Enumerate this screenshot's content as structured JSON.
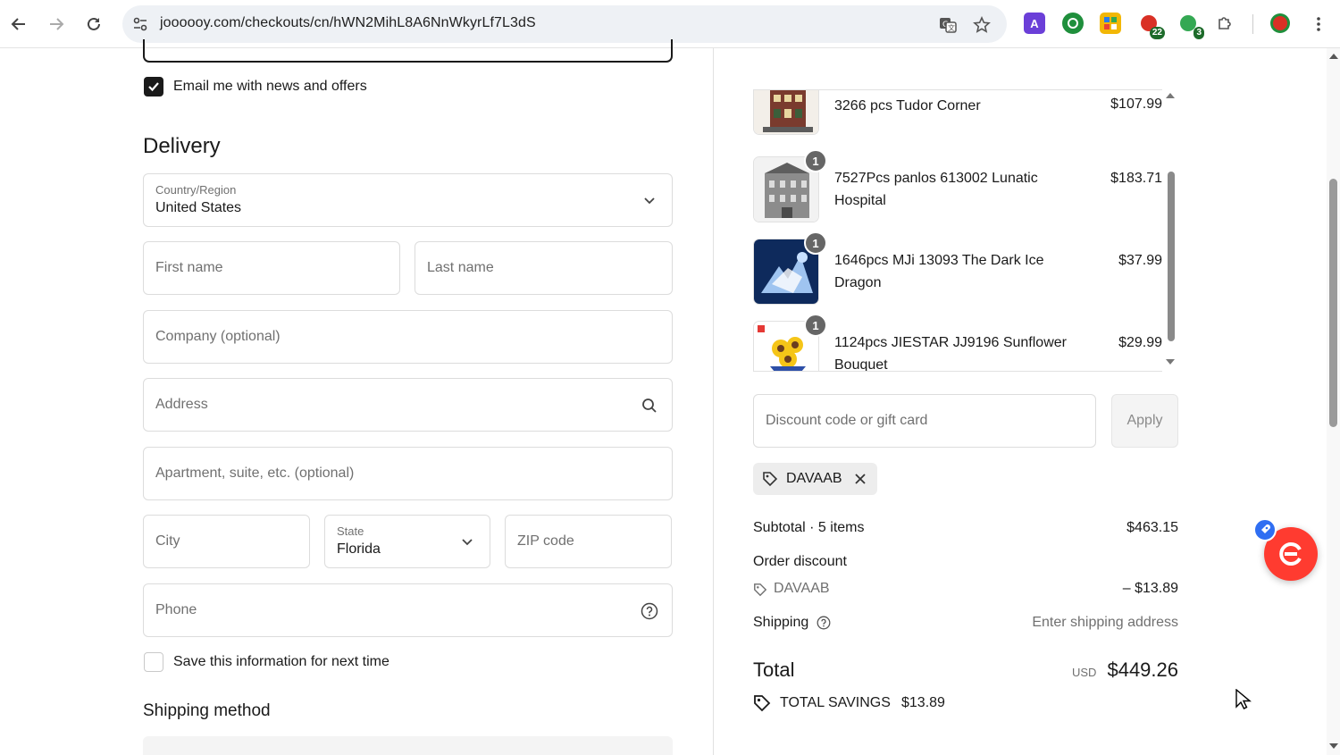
{
  "browser": {
    "url": "joooooy.com/checkouts/cn/hWN2MihL8A6NnWkyrLf7L3dS",
    "extensions": [
      {
        "name": "A",
        "color": "#6b3fd8"
      },
      {
        "name": "",
        "color": "#1f8f3c"
      },
      {
        "name": "",
        "color": "#f2b705"
      },
      {
        "name": "22",
        "color": "#d93025"
      },
      {
        "name": "3",
        "color": "#1d6b2a"
      }
    ]
  },
  "form": {
    "email_offers_label": "Email me with news and offers",
    "delivery_title": "Delivery",
    "country": {
      "label": "Country/Region",
      "value": "United States"
    },
    "first_name_placeholder": "First name",
    "last_name_placeholder": "Last name",
    "company_placeholder": "Company (optional)",
    "address_placeholder": "Address",
    "apartment_placeholder": "Apartment, suite, etc. (optional)",
    "city_placeholder": "City",
    "state": {
      "label": "State",
      "value": "Florida"
    },
    "zip_placeholder": "ZIP code",
    "phone_placeholder": "Phone",
    "save_info_label": "Save this information for next time",
    "shipping_method_title": "Shipping method"
  },
  "summary": {
    "products": [
      {
        "name": "3266 pcs Tudor Corner",
        "price": "$107.99",
        "qty": ""
      },
      {
        "name": "7527Pcs panlos 613002 Lunatic Hospital",
        "price": "$183.71",
        "qty": "1"
      },
      {
        "name": "1646pcs MJi 13093 The Dark Ice Dragon",
        "price": "$37.99",
        "qty": "1"
      },
      {
        "name": "1124pcs JIESTAR JJ9196 Sunflower Bouquet",
        "price": "$29.99",
        "qty": "1"
      }
    ],
    "discount_placeholder": "Discount code or gift card",
    "apply_label": "Apply",
    "applied_code": "DAVAAB",
    "subtotal_label": "Subtotal · 5 items",
    "subtotal_value": "$463.15",
    "order_discount_label": "Order discount",
    "discount_code": "DAVAAB",
    "discount_value": "– $13.89",
    "shipping_label": "Shipping",
    "shipping_value": "Enter shipping address",
    "total_label": "Total",
    "currency": "USD",
    "total_value": "$449.26",
    "savings_label": "TOTAL SAVINGS",
    "savings_value": "$13.89"
  }
}
